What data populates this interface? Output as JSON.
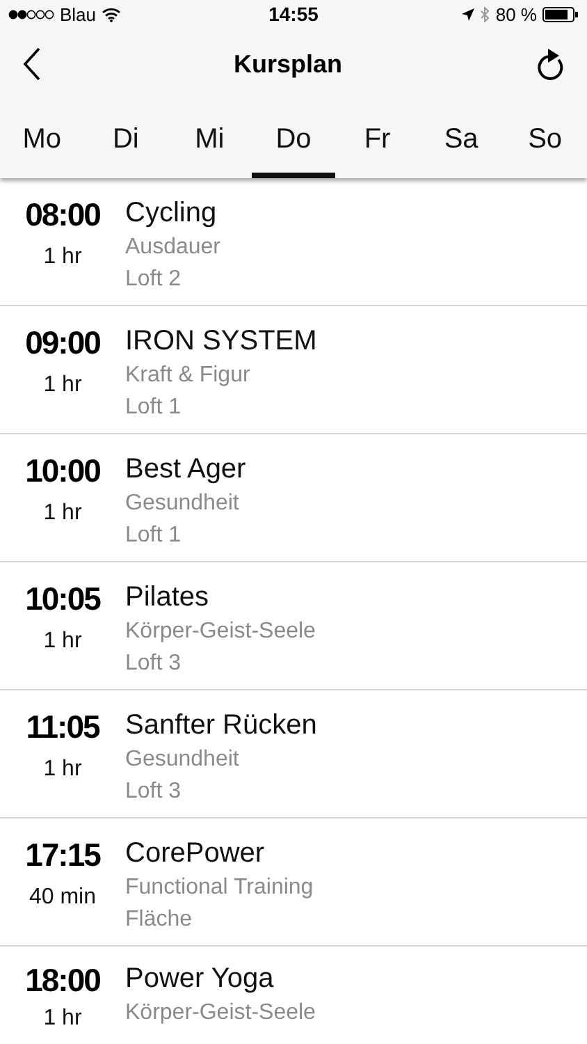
{
  "status_bar": {
    "carrier": "Blau",
    "time": "14:55",
    "battery": "80 %"
  },
  "nav": {
    "title": "Kursplan"
  },
  "tabs": [
    {
      "label": "Mo",
      "selected": false
    },
    {
      "label": "Di",
      "selected": false
    },
    {
      "label": "Mi",
      "selected": false
    },
    {
      "label": "Do",
      "selected": true
    },
    {
      "label": "Fr",
      "selected": false
    },
    {
      "label": "Sa",
      "selected": false
    },
    {
      "label": "So",
      "selected": false
    }
  ],
  "classes": [
    {
      "time": "08:00",
      "duration": "1 hr",
      "name": "Cycling",
      "category": "Ausdauer",
      "room": "Loft 2"
    },
    {
      "time": "09:00",
      "duration": "1 hr",
      "name": "IRON SYSTEM",
      "category": "Kraft & Figur",
      "room": "Loft 1"
    },
    {
      "time": "10:00",
      "duration": "1 hr",
      "name": "Best Ager",
      "category": "Gesundheit",
      "room": "Loft 1"
    },
    {
      "time": "10:05",
      "duration": "1 hr",
      "name": "Pilates",
      "category": "Körper-Geist-Seele",
      "room": "Loft 3"
    },
    {
      "time": "11:05",
      "duration": "1 hr",
      "name": "Sanfter Rücken",
      "category": "Gesundheit",
      "room": "Loft 3"
    },
    {
      "time": "17:15",
      "duration": "40 min",
      "name": "CorePower",
      "category": "Functional Training",
      "room": "Fläche"
    },
    {
      "time": "18:00",
      "duration": "1 hr",
      "name": "Power Yoga",
      "category": "Körper-Geist-Seele"
    }
  ]
}
